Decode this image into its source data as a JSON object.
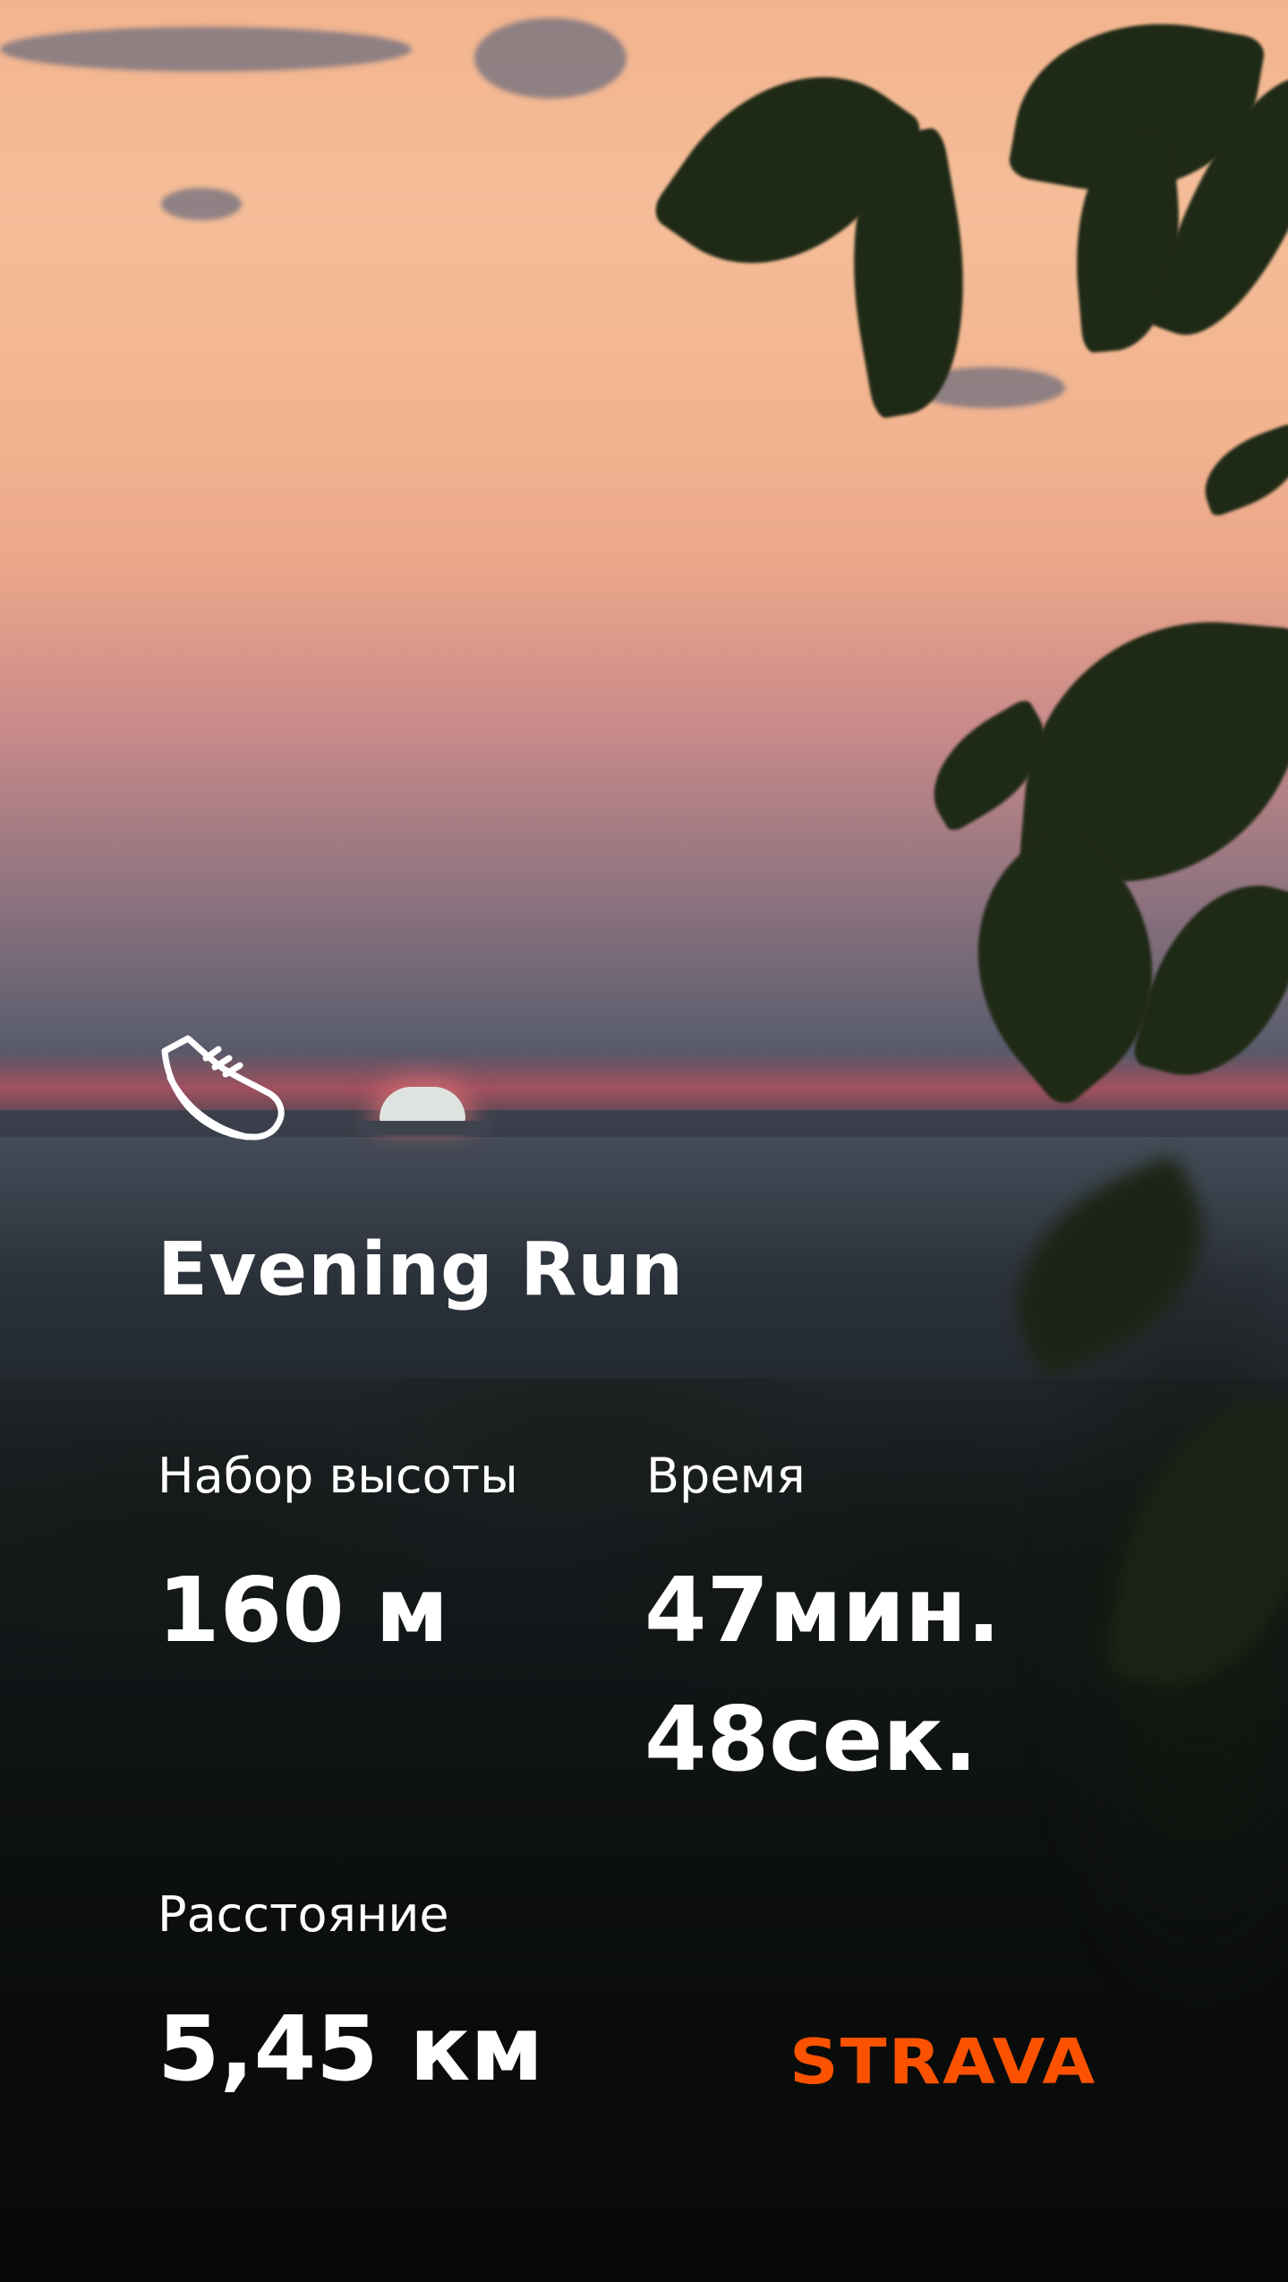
{
  "activity": {
    "icon": "running-shoe-icon",
    "title": "Evening Run"
  },
  "stats": {
    "elevation": {
      "label": "Набор высоты",
      "value": "160 м"
    },
    "time": {
      "label": "Время",
      "value_line1": "47мин.",
      "value_line2": "48сек."
    },
    "distance": {
      "label": "Расстояние",
      "value": "5,45 км"
    }
  },
  "brand": {
    "name": "STRAVA",
    "color": "#fc5200"
  },
  "colors": {
    "text": "#ffffff"
  }
}
